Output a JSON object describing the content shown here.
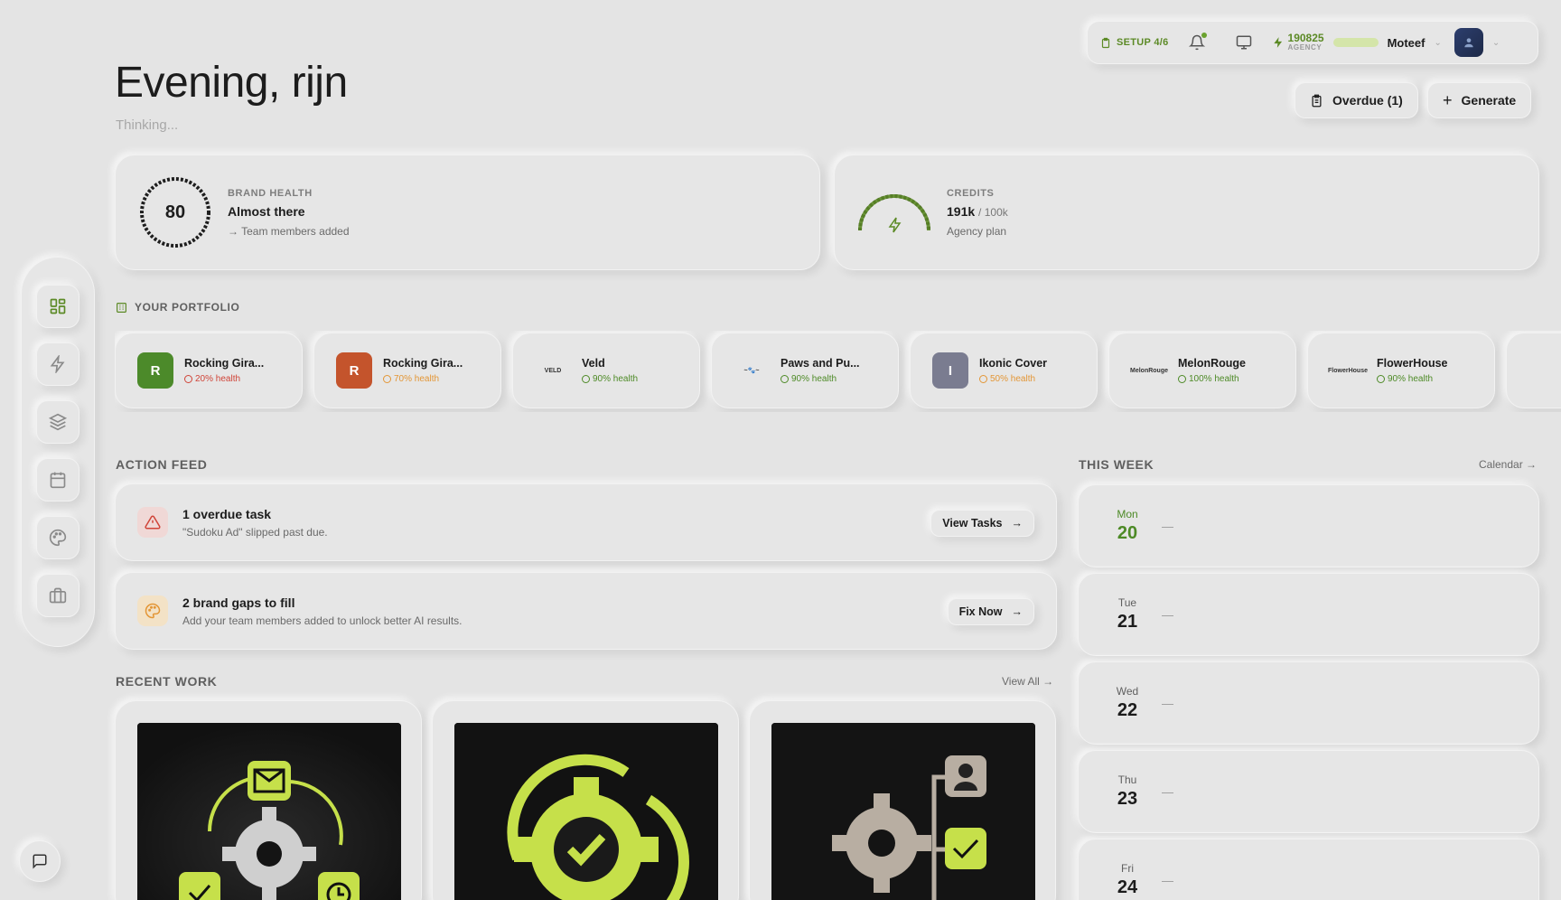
{
  "topbar": {
    "setup_label": "SETUP 4/6",
    "credits_value": "190825",
    "credits_label": "AGENCY",
    "user_name": "Moteef"
  },
  "header": {
    "greeting": "Evening, rijn",
    "status": "Thinking...",
    "overdue_label": "Overdue (1)",
    "generate_label": "Generate"
  },
  "brand_health": {
    "label": "BRAND HEALTH",
    "score": "80",
    "score_fraction": 0.8,
    "status": "Almost there",
    "note": "→ Team members added"
  },
  "credits": {
    "label": "CREDITS",
    "used": "191k",
    "total": "/ 100k",
    "plan": "Agency plan"
  },
  "portfolio": {
    "title": "YOUR PORTFOLIO",
    "brands": [
      {
        "name": "Rocking Gira...",
        "health": "20% health",
        "initial": "R",
        "logo_color": "#4c8a2a",
        "status": "red"
      },
      {
        "name": "Rocking Gira...",
        "health": "70% health",
        "initial": "R",
        "logo_color": "#c4542c",
        "status": "orange"
      },
      {
        "name": "Veld",
        "health": "90% health",
        "initial": "VELD",
        "status": "green"
      },
      {
        "name": "Paws and Pu...",
        "health": "90% health",
        "initial": "~🐾~",
        "status": "green"
      },
      {
        "name": "Ikonic Cover",
        "health": "50% health",
        "initial": "I",
        "logo_color": "#7a7c90",
        "status": "orange"
      },
      {
        "name": "MelonRouge",
        "health": "100% health",
        "initial": "MelonRouge",
        "status": "green"
      },
      {
        "name": "FlowerHouse",
        "health": "90% health",
        "initial": "FlowerHouse",
        "status": "green"
      }
    ]
  },
  "action_feed": {
    "title": "ACTION FEED",
    "items": [
      {
        "title": "1 overdue task",
        "subtitle": "\"Sudoku Ad\" slipped past due.",
        "button": "View Tasks"
      },
      {
        "title": "2 brand gaps to fill",
        "subtitle": "Add your team members added to unlock better AI results.",
        "button": "Fix Now"
      }
    ]
  },
  "this_week": {
    "title": "THIS WEEK",
    "calendar_link": "Calendar →",
    "days": [
      {
        "name": "Mon",
        "num": "20",
        "event": "—"
      },
      {
        "name": "Tue",
        "num": "21",
        "event": "—"
      },
      {
        "name": "Wed",
        "num": "22",
        "event": "—"
      },
      {
        "name": "Thu",
        "num": "23",
        "event": "—"
      },
      {
        "name": "Fri",
        "num": "24",
        "event": "—"
      }
    ]
  },
  "recent_work": {
    "title": "RECENT WORK",
    "view_all": "View All →"
  },
  "colors": {
    "accent": "#5c8a26",
    "lime": "#c6e04a",
    "background": "#e4e4e4"
  }
}
